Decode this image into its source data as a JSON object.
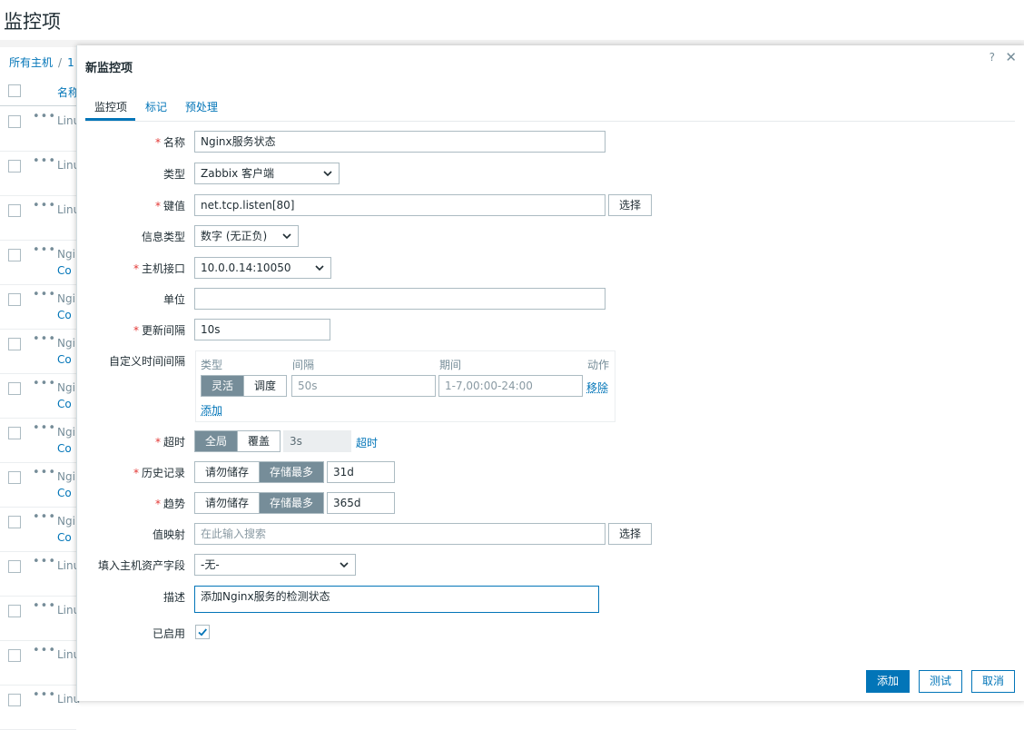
{
  "page": {
    "title": "监控项",
    "breadcrumb": [
      "所有主机",
      "1"
    ],
    "table_header": "名称",
    "rows": [
      {
        "name1": "Linu",
        "name2": ""
      },
      {
        "name1": "Linu",
        "name2": ""
      },
      {
        "name1": "Linu",
        "name2": ""
      },
      {
        "name1": "Ngi",
        "name2": "Co"
      },
      {
        "name1": "Ngi",
        "name2": "Co"
      },
      {
        "name1": "Ngi",
        "name2": "Co"
      },
      {
        "name1": "Ngi",
        "name2": "Co"
      },
      {
        "name1": "Ngi",
        "name2": "Co"
      },
      {
        "name1": "Ngi",
        "name2": "Co"
      },
      {
        "name1": "Ngi",
        "name2": "Co"
      },
      {
        "name1": "Linu",
        "name2": ""
      },
      {
        "name1": "Linu",
        "name2": ""
      },
      {
        "name1": "Linu",
        "name2": ""
      },
      {
        "name1": "Linu",
        "name2": ""
      }
    ],
    "row_menu": "•••"
  },
  "dialog": {
    "title": "新监控项",
    "help": "?",
    "close": "✕",
    "tabs": [
      "监控项",
      "标记",
      "预处理"
    ],
    "active_tab": "监控项",
    "required_mark": "*",
    "form": {
      "name": {
        "label": "名称",
        "value": "Nginx服务状态"
      },
      "type": {
        "label": "类型",
        "value": "Zabbix 客户端"
      },
      "key": {
        "label": "键值",
        "value": "net.tcp.listen[80]",
        "button": "选择"
      },
      "info_type": {
        "label": "信息类型",
        "value": "数字 (无正负)"
      },
      "interface": {
        "label": "主机接口",
        "value": "10.0.0.14:10050"
      },
      "units": {
        "label": "单位",
        "value": ""
      },
      "update_interval": {
        "label": "更新间隔",
        "value": "10s"
      },
      "custom_intervals": {
        "label": "自定义时间间隔",
        "headers": [
          "类型",
          "间隔",
          "期间",
          "动作"
        ],
        "row": {
          "type_options": [
            "灵活",
            "调度"
          ],
          "type_selected": "灵活",
          "interval_placeholder": "50s",
          "period_placeholder": "1-7,00:00-24:00",
          "remove": "移除"
        },
        "add": "添加"
      },
      "timeout": {
        "label": "超时",
        "options": [
          "全局",
          "覆盖"
        ],
        "selected": "全局",
        "value": "3s",
        "link": "超时"
      },
      "history": {
        "label": "历史记录",
        "options": [
          "请勿储存",
          "存储最多"
        ],
        "selected": "存储最多",
        "value": "31d"
      },
      "trends": {
        "label": "趋势",
        "options": [
          "请勿储存",
          "存储最多"
        ],
        "selected": "存储最多",
        "value": "365d"
      },
      "valuemap": {
        "label": "值映射",
        "placeholder": "在此输入搜索",
        "button": "选择"
      },
      "inventory": {
        "label": "填入主机资产字段",
        "value": "-无-"
      },
      "description": {
        "label": "描述",
        "value": "添加Nginx服务的检测状态"
      },
      "enabled": {
        "label": "已启用",
        "checked": true
      }
    },
    "buttons": {
      "add": "添加",
      "test": "测试",
      "cancel": "取消"
    }
  },
  "colors": {
    "accent": "#0275b8",
    "required": "#e33734",
    "segment_active": "#768d99"
  }
}
